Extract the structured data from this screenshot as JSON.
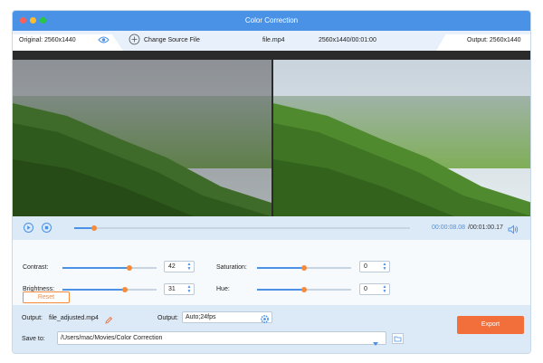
{
  "window": {
    "title": "Color Correction"
  },
  "infobar": {
    "original_label": "Original: 2560x1440",
    "change_source_label": "Change Source File",
    "file_name": "file.mp4",
    "file_meta": "2560x1440/00:01:00",
    "output_label": "Output: 2560x1440"
  },
  "player": {
    "progress": 0.06,
    "current_time": "00:00:08.08",
    "total_time": "/00:01:00.17"
  },
  "adjustments": {
    "contrast": {
      "label": "Contrast:",
      "value": "42",
      "level": 0.71
    },
    "brightness": {
      "label": "Brightness:",
      "value": "31",
      "level": 0.66
    },
    "saturation": {
      "label": "Saturation:",
      "value": "0",
      "level": 0.5
    },
    "hue": {
      "label": "Hue:",
      "value": "0",
      "level": 0.5
    },
    "reset_label": "Reset"
  },
  "output": {
    "label": "Output:",
    "file_name": "file_adjusted.mp4",
    "format_label": "Output:",
    "format_value": "Auto;24fps",
    "save_label": "Save to:",
    "save_path": "/Users/mac/Movies/Color Correction",
    "export_label": "Export"
  },
  "icons": {
    "eye": "eye-icon",
    "add": "add-circle-icon",
    "play": "play-icon",
    "stop": "stop-icon",
    "volume": "volume-icon",
    "edit": "pencil-icon",
    "gear": "gear-icon",
    "dropdown": "chevron-down-icon",
    "folder": "folder-icon"
  },
  "colors": {
    "accent": "#4a92e6",
    "orange": "#f26f3b",
    "knob": "#f58a3a",
    "titlebar": "#4a92e6"
  }
}
